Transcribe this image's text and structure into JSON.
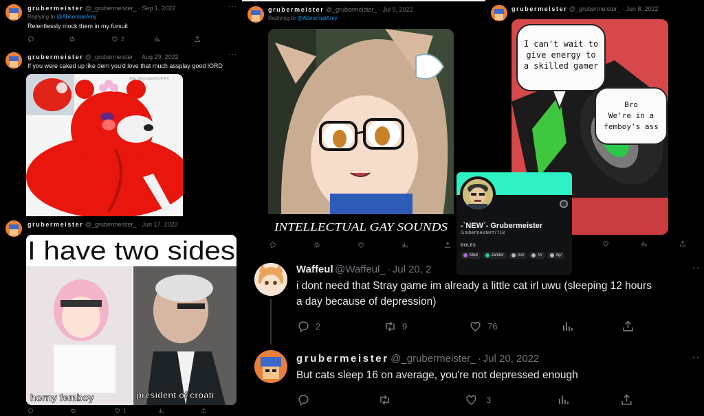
{
  "tweets": [
    {
      "name": "grubermeister",
      "handle": "@_grubermeister_",
      "date": "Sep 1, 2022",
      "replying_prefix": "Replying to ",
      "replying_to": "@AbnormalAmy",
      "text": "Relentlessly mock them in my fursuit",
      "likes": "2"
    },
    {
      "name": "grubermeister",
      "handle": "@_grubermeister_",
      "date": "Aug 29, 2022",
      "text": "If you were caked up like dem you'd love that much assplay good lORD",
      "watermark": "Alter_Alternative/KLIR-RC"
    },
    {
      "name": "grubermeister",
      "handle": "@_grubermeister_",
      "date": "Jun 17, 2022",
      "meme_title": "I have two sides",
      "meme_left": "horny femboy",
      "meme_right": "president of croati",
      "likes": "1"
    },
    {
      "name": "grubermeister",
      "handle": "@_grubermeister_",
      "date": "Jul 9, 2022",
      "replying_prefix": "Replying to ",
      "replying_to": "@AbnormalAmy",
      "caption": "INTELLECTUAL GAY SOUNDS"
    },
    {
      "name": "grubermeister",
      "handle": "@_grubermeister_",
      "date": "Jun 8, 2022",
      "bubble1": [
        "I can't wait to",
        "give energy to",
        "a skilled gamer"
      ],
      "bubble2": [
        "Bro",
        "We're in a",
        "femboy's ass"
      ]
    },
    {
      "name": "Waffeul",
      "handle": "@Waffeul_",
      "date": "Jul 20, 2",
      "text_lines": [
        "i dont need that Stray game im already a little cat irl uwu (sleeping 12 hours",
        "a day because of depression)"
      ],
      "replies": "2",
      "retweets": "9",
      "likes": "76"
    },
    {
      "name": "grubermeister",
      "handle": "@_grubermeister_",
      "date": "Jul 20, 2022",
      "text": "But cats sleep 16 on average, you're not depressed enough",
      "likes": "3"
    }
  ],
  "separator": "·",
  "discord": {
    "display_name": "-`NEW´- Grubermeister",
    "tag": "Grubermeister#7718",
    "roles_label": "ROLES",
    "roles": [
      {
        "name": "Mod",
        "color": "#b36ad9"
      },
      {
        "name": "Janitor",
        "color": "#2ecc9a"
      },
      {
        "name": "/co/",
        "color": "#b5bac1"
      },
      {
        "name": "/v/",
        "color": "#b5bac1"
      },
      {
        "name": "/tg/",
        "color": "#b5bac1"
      }
    ],
    "banner_color": "#2ef2c3"
  },
  "colors": {
    "background": "#000000",
    "text": "#e7e9ea",
    "muted": "#71767b",
    "link": "#1d9bf0"
  },
  "icons": [
    "reply-icon",
    "retweet-icon",
    "like-icon",
    "views-icon",
    "share-icon",
    "more-icon"
  ]
}
